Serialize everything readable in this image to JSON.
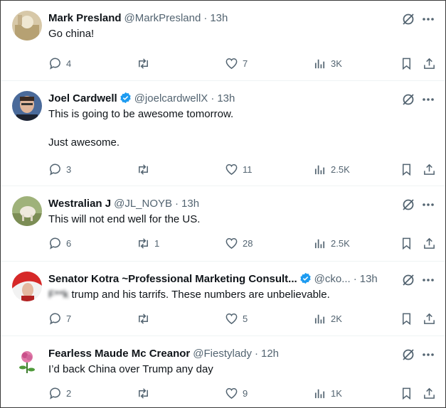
{
  "tweets": [
    {
      "name": "Mark Presland",
      "handle": "@MarkPresland",
      "time": "13h",
      "text": "Go china!",
      "replies": "4",
      "retweets": "",
      "likes": "7",
      "views": "3K",
      "avatar_icon": "avatar-photo"
    },
    {
      "name": "Joel Cardwell",
      "handle": "@joelcardwellX",
      "time": "13h",
      "text": "This is going to be awesome tomorrow.\n\nJust awesome.",
      "replies": "3",
      "retweets": "",
      "likes": "11",
      "views": "2.5K",
      "verified": true
    },
    {
      "name": "Westralian J",
      "handle": "@JL_NOYB",
      "time": "13h",
      "text": "This will not end well for the US.",
      "replies": "6",
      "retweets": "1",
      "likes": "28",
      "views": "2.5K"
    },
    {
      "name": "Senator Kotra ~Professional Marketing Consult...",
      "handle": "@cko...",
      "time": "13h",
      "text_censored": "F**k",
      "text_rest": " trump and his tarrifs. These numbers are unbelievable.",
      "replies": "7",
      "retweets": "",
      "likes": "5",
      "views": "2K",
      "verified": true
    },
    {
      "name": "Fearless Maude Mc Creanor",
      "handle": "@Fiestylady",
      "time": "12h",
      "text": "I’d back China over Trump any day",
      "replies": "2",
      "retweets": "",
      "likes": "9",
      "views": "1K"
    }
  ],
  "icons": {
    "reply": "reply-icon",
    "retweet": "retweet-icon",
    "like": "heart-icon",
    "views": "views-icon",
    "bookmark": "bookmark-icon",
    "share": "share-icon",
    "grok": "grok-icon",
    "more": "more-icon"
  },
  "colors": {
    "text": "#0f1419",
    "secondary": "#536471",
    "verified": "#1d9bf0",
    "divider": "#eff3f4"
  }
}
